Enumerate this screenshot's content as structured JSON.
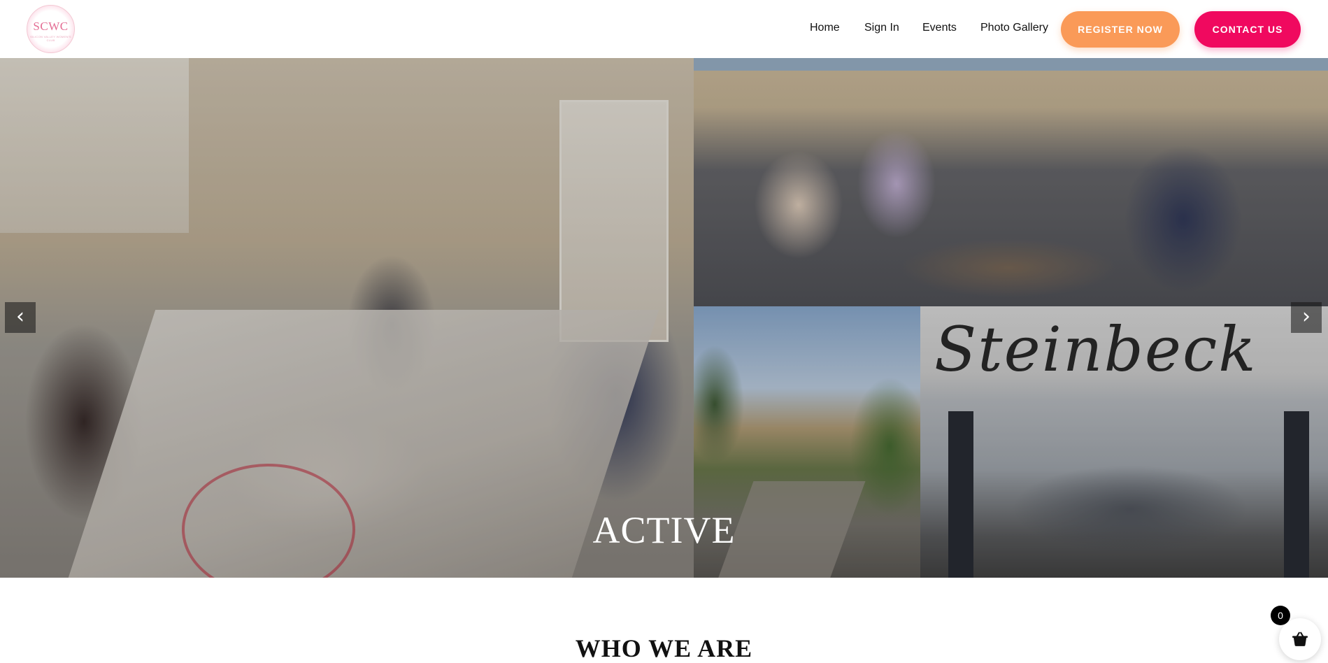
{
  "header": {
    "logo": {
      "text": "SCWC",
      "subtext": "SILICON VALLEY WOMEN'S CLUB"
    },
    "nav": [
      {
        "label": "Home"
      },
      {
        "label": "Sign In"
      },
      {
        "label": "Events"
      },
      {
        "label": "Photo Gallery"
      }
    ],
    "register_label": "REGISTER NOW",
    "contact_label": "CONTACT US",
    "colors": {
      "register": "#fa9a58",
      "contact": "#f0095f"
    }
  },
  "hero": {
    "caption": "ACTIVE",
    "steinbeck_sign": "Steinbeck",
    "prev_icon": "chevron-left-icon",
    "next_icon": "chevron-right-icon"
  },
  "section": {
    "title": "WHO WE ARE"
  },
  "cart": {
    "count": "0",
    "icon": "basket-icon"
  }
}
